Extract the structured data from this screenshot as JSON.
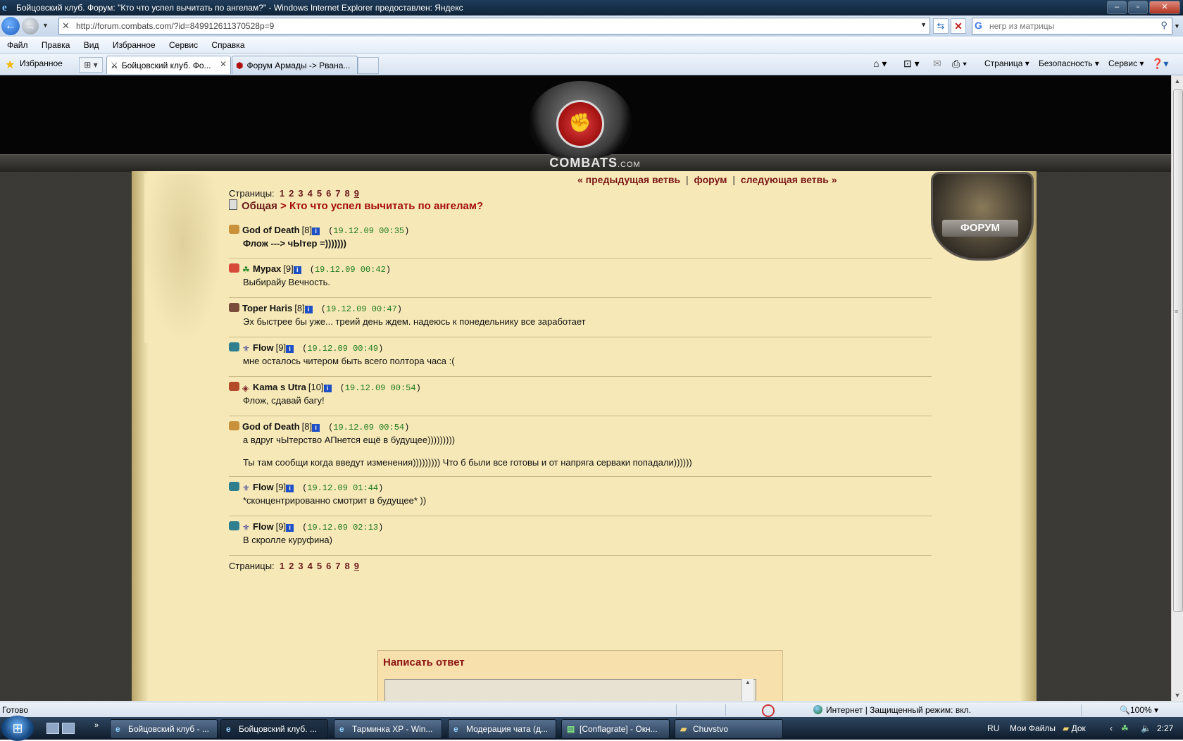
{
  "window": {
    "title": "Бойцовский клуб. Форум: \"Кто что успел вычитать по ангелам?\" - Windows Internet Explorer предоставлен: Яндекс",
    "controls": [
      "–",
      "▫",
      "✕"
    ]
  },
  "address": {
    "url": "http://forum.combats.com/?id=849912611370528p=9",
    "search_placeholder": "негр из матрицы"
  },
  "menu": [
    "Файл",
    "Правка",
    "Вид",
    "Избранное",
    "Сервис",
    "Справка"
  ],
  "tabs": {
    "favorites_label": "Избранное",
    "items": [
      {
        "label": "Бойцовский клуб. Фо...",
        "active": true
      },
      {
        "label": "Форум Армады -> Рвана...",
        "active": false
      }
    ]
  },
  "commands": [
    "Страница",
    "Безопасность",
    "Сервис"
  ],
  "site": {
    "logo_text": "COMBATS",
    "logo_suffix": ".COM",
    "badge_label": "ФОРУМ"
  },
  "forum": {
    "nav": {
      "prev": "« предыдущая ветвь",
      "forum": "форум",
      "next": "следующая ветвь »",
      "sep": "|"
    },
    "pages_label": "Страницы:",
    "pages": [
      "1",
      "2",
      "3",
      "4",
      "5",
      "6",
      "7",
      "8"
    ],
    "current_page": "9",
    "section": "Общая",
    "topic": "> Кто что успел вычитать по ангелам?",
    "posts": [
      {
        "clan_color": "#c8913a",
        "align": "",
        "nick": "God of Death",
        "level": "[8]",
        "date": "19.12.09 00:35",
        "body": [
          "Флож ---> чЫтер =)))))))"
        ],
        "strong": true
      },
      {
        "clan_color": "#d64a3a",
        "align": "☘",
        "nick": "Мурах",
        "level": "[9]",
        "date": "19.12.09 00:42",
        "body": [
          "Выбирайу Вечность."
        ],
        "strong": false
      },
      {
        "clan_color": "#7a4c3a",
        "align": "",
        "nick": "Toper Haris",
        "level": "[8]",
        "date": "19.12.09 00:47",
        "body": [
          "Эх быстрее бы уже... треий день ждем. надеюсь к понедельнику все заработает"
        ],
        "strong": false
      },
      {
        "clan_color": "#2f7f8f",
        "align": "⚜",
        "nick": "Flow",
        "level": "[9]",
        "date": "19.12.09 00:49",
        "body": [
          "мне осталось читером быть всего полтора часа :("
        ],
        "strong": false
      },
      {
        "clan_color": "#b34a2a",
        "align": "◈",
        "nick": "Kama s Utra",
        "level": "[10]",
        "date": "19.12.09 00:54",
        "body": [
          "Флож, сдавай багу!"
        ],
        "strong": false
      },
      {
        "clan_color": "#c8913a",
        "align": "",
        "nick": "God of Death",
        "level": "[8]",
        "date": "19.12.09 00:54",
        "body": [
          "а вдруг чЫтерство АПнется ещё в будущее)))))))))",
          "Ты там сообщи когда введут изменения))))))))) Что б были все готовы и от напряга серваки попадали))))))"
        ],
        "strong": false
      },
      {
        "clan_color": "#2f7f8f",
        "align": "⚜",
        "nick": "Flow",
        "level": "[9]",
        "date": "19.12.09 01:44",
        "body": [
          "*сконцентрированно смотрит в будущее* ))"
        ],
        "strong": false
      },
      {
        "clan_color": "#2f7f8f",
        "align": "⚜",
        "nick": "Flow",
        "level": "[9]",
        "date": "19.12.09 02:13",
        "body": [
          "В скролле куруфина)"
        ],
        "strong": false
      }
    ],
    "reply_title": "Написать ответ"
  },
  "status": {
    "left": "Готово",
    "zone": "Интернет | Защищенный режим: вкл.",
    "zoom": "100%"
  },
  "taskbar": {
    "items": [
      {
        "label": "Бойцовский клуб - ...",
        "active": false
      },
      {
        "label": "Бойцовский клуб. ...",
        "active": true
      },
      {
        "label": "Тарминка XP - Win...",
        "active": false
      },
      {
        "label": "Модерация чата (д...",
        "active": false
      },
      {
        "label": "[Conflagrate] - Окн...",
        "active": false
      },
      {
        "label": "Chuvstvo",
        "active": false
      }
    ],
    "lang": "RU",
    "my_files": "Мои Файлы",
    "docs": "Док",
    "time": "2:27"
  }
}
